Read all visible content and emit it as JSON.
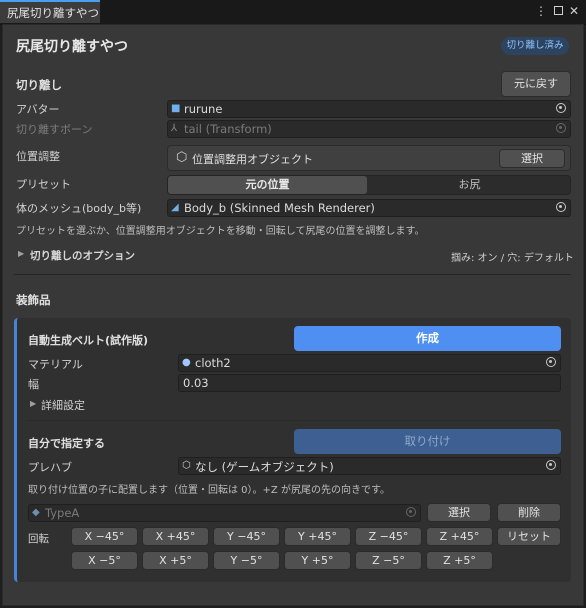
{
  "tab": {
    "title": "尻尾切り離すやつ"
  },
  "header": {
    "title": "尻尾切り離すやつ",
    "badge": "切り離し済み"
  },
  "detach": {
    "section": "切り離し",
    "revert_button": "元に戻す",
    "avatar_label": "アバター",
    "avatar_value": "rurune",
    "bone_label": "切り離すボーン",
    "bone_value": "tail (Transform)",
    "position_label": "位置調整",
    "position_value": "位置調整用オブジェクト",
    "select_button": "選択",
    "preset_label": "プリセット",
    "preset_options": [
      "元の位置",
      "お尻"
    ],
    "mesh_label": "体のメッシュ(body_b等)",
    "mesh_value": "Body_b (Skinned Mesh Renderer)",
    "hint": "プリセットを選ぶか、位置調整用オブジェクトを移動・回転して尻尾の位置を調整します。",
    "options_foldout": "切り離しのオプション",
    "options_summary": "掴み: オン / 穴: デフォルト"
  },
  "decor": {
    "section": "装飾品",
    "auto_belt_label": "自動生成ベルト(試作版)",
    "create_button": "作成",
    "material_label": "マテリアル",
    "material_value": "cloth2",
    "width_label": "幅",
    "width_value": "0.03",
    "advanced_foldout": "詳細設定",
    "manual_label": "自分で指定する",
    "attach_button": "取り付け",
    "prefab_label": "プレハブ",
    "prefab_value": "なし (ゲームオブジェクト)",
    "manual_hint": "取り付け位置の子に配置します（位置・回転は 0）。+Z が尻尾の先の向きです。",
    "type_placeholder": "TypeA",
    "type_select": "選択",
    "type_delete": "削除",
    "rotate_label": "回転",
    "rotate_row1": [
      "X −45°",
      "X +45°",
      "Y −45°",
      "Y +45°",
      "Z −45°",
      "Z +45°"
    ],
    "rotate_row2": [
      "X −5°",
      "X +5°",
      "Y −5°",
      "Y +5°",
      "Z −5°",
      "Z +5°"
    ],
    "reset_button": "リセット"
  },
  "colors": {
    "accent": "#4f8ff2",
    "badge_text": "#8fc4ff",
    "panel_bar": "#4a82d6"
  }
}
